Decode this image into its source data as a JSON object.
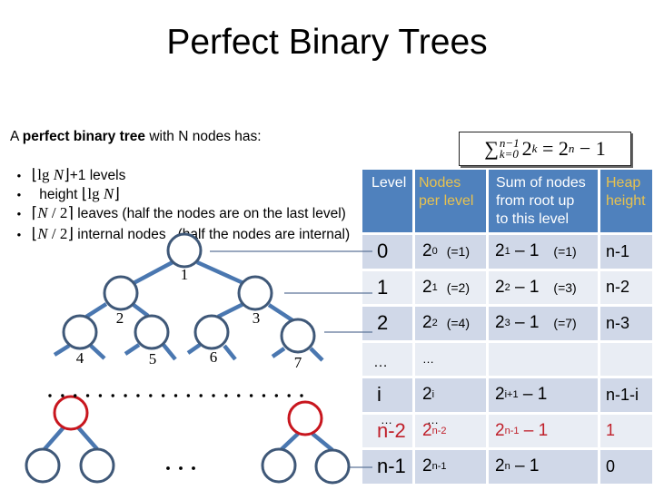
{
  "slide": {
    "title": "Perfect Binary Trees"
  },
  "intro": {
    "prefix": "A ",
    "bold": "perfect binary tree",
    "suffix": " with N nodes has:"
  },
  "bullets": [
    {
      "symbol": "•",
      "before": "",
      "math": {
        "left": "⌊",
        "fn": "lg ",
        "var": "N",
        "op": "",
        "right": "⌋"
      },
      "after": "+1 levels"
    },
    {
      "symbol": "•",
      "before": "  height ",
      "math": {
        "left": "⌊",
        "fn": "lg ",
        "var": "N",
        "op": "",
        "right": "⌋"
      },
      "after": ""
    },
    {
      "symbol": "•",
      "before": "",
      "math": {
        "left": "⌈",
        "fn": "",
        "var": "N",
        "op": " / 2",
        "right": "⌉"
      },
      "after": " leaves (half the nodes are on the last level)"
    },
    {
      "symbol": "•",
      "before": "",
      "math": {
        "left": "⌊",
        "fn": "",
        "var": "N",
        "op": " / 2",
        "right": "⌋"
      },
      "after": " internal nodes   (half the nodes are internal)"
    }
  ],
  "formula": {
    "sigma": "∑",
    "upper": "n−1",
    "lower": "k=0",
    "base": "2",
    "exp": "k",
    "eq": " = 2",
    "rhs_exp": "n",
    "rhs_tail": " − 1"
  },
  "table": {
    "headers": [
      {
        "line1": "Level",
        "line2": "",
        "line3": ""
      },
      {
        "line1": "Nodes",
        "line2": "per level",
        "line3": ""
      },
      {
        "line1": "Sum of nodes",
        "line2": "from root up",
        "line3": "to this level"
      },
      {
        "line1": "Heap",
        "line2": "height",
        "line3": ""
      }
    ],
    "rows": [
      {
        "level": "0",
        "nodes": {
          "base": "2",
          "sup": "0",
          "note": "(=1)"
        },
        "sum": {
          "base": "2",
          "sup": "1",
          "tail": " – 1",
          "note": "(=1)"
        },
        "height": "n-1"
      },
      {
        "level": "1",
        "nodes": {
          "base": "2",
          "sup": "1",
          "note": "(=2)"
        },
        "sum": {
          "base": "2",
          "sup": "2",
          "tail": " – 1",
          "note": "(=3)"
        },
        "height": "n-2"
      },
      {
        "level": "2",
        "nodes": {
          "base": "2",
          "sup": "2",
          "note": "(=4)"
        },
        "sum": {
          "base": "2",
          "sup": "3",
          "tail": " – 1",
          "note": "(=7)"
        },
        "height": "n-3"
      },
      {
        "level": "…",
        "nodes": {
          "base": "…"
        },
        "sum": {},
        "height": ""
      },
      {
        "level": "i",
        "nodes": {
          "base": "2",
          "sup": "i"
        },
        "sum": {
          "base": "2",
          "sup": "i+1",
          "tail": " – 1"
        },
        "height": "n-1-i"
      },
      {
        "level": "n-2",
        "level_above": "…",
        "nodes": {
          "base": "2",
          "sup": "n-2",
          "above": "…"
        },
        "sum": {
          "base": "2",
          "sup": "n-1",
          "tail": " – 1"
        },
        "height": "1",
        "highlight": true
      },
      {
        "level": "n-1",
        "nodes": {
          "base": "2",
          "sup": "n-1"
        },
        "sum": {
          "base": "2",
          "sup": "n",
          "tail": " – 1"
        },
        "height": "0"
      }
    ]
  },
  "tree": {
    "node_labels": [
      "1",
      "2",
      "3",
      "4",
      "5",
      "6",
      "7"
    ]
  },
  "colors": {
    "header_bg": "#4F81BD",
    "gold": "#E8C24F",
    "row_dark": "#D0D8E8",
    "row_light": "#E9EDF4",
    "red": "#C0202A",
    "edge": "#4A77B0",
    "node_stroke": "#3F5878",
    "red_node": "#C8161E",
    "connector": "#5D7599"
  }
}
